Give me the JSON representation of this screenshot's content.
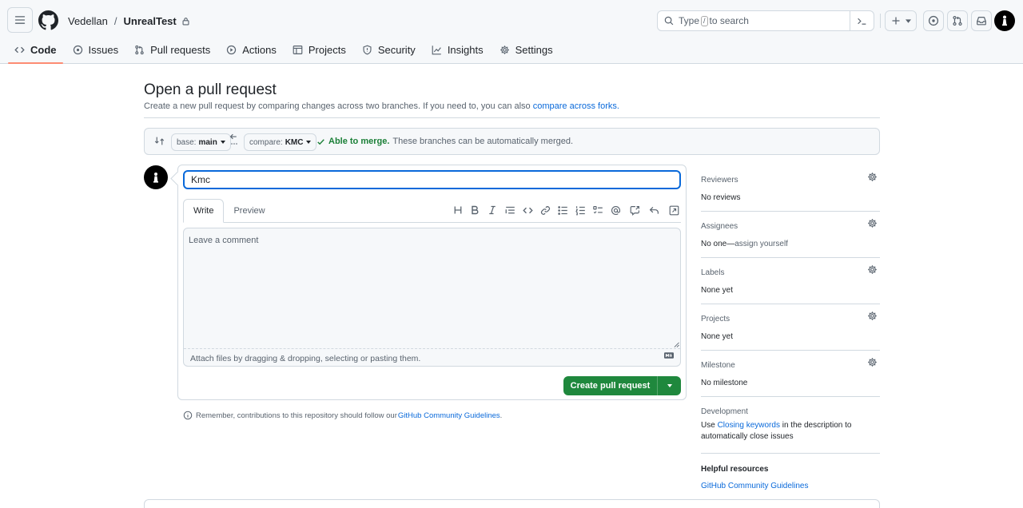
{
  "header": {
    "owner": "Vedellan",
    "separator": "/",
    "repo": "UnrealTest",
    "search": {
      "prefix": "Type",
      "key": "/",
      "suffix": "to search"
    }
  },
  "tabs": [
    {
      "label": "Code",
      "icon": "code-icon"
    },
    {
      "label": "Issues",
      "icon": "issue-opened-icon"
    },
    {
      "label": "Pull requests",
      "icon": "git-pull-request-icon"
    },
    {
      "label": "Actions",
      "icon": "play-icon"
    },
    {
      "label": "Projects",
      "icon": "table-icon"
    },
    {
      "label": "Security",
      "icon": "shield-icon"
    },
    {
      "label": "Insights",
      "icon": "graph-icon"
    },
    {
      "label": "Settings",
      "icon": "gear-icon"
    }
  ],
  "main": {
    "title": "Open a pull request",
    "subtitle": "Create a new pull request by comparing changes across two branches. If you need to, you can also",
    "subtitle_link": "compare across forks."
  },
  "range": {
    "base_label": "base:",
    "base_branch": "main",
    "compare_label": "compare:",
    "compare_branch": "KMC",
    "merge_status": "Able to merge.",
    "merge_detail": "These branches can be automatically merged."
  },
  "form": {
    "title_value": "Kmc",
    "tab_write": "Write",
    "tab_preview": "Preview",
    "comment_placeholder": "Leave a comment",
    "attach_hint": "Attach files by dragging & dropping, selecting or pasting them.",
    "submit_label": "Create pull request",
    "remember_text": "Remember, contributions to this repository should follow our",
    "remember_link": "GitHub Community Guidelines",
    "remember_end": "."
  },
  "sidebar": {
    "reviewers": {
      "title": "Reviewers",
      "value": "No reviews"
    },
    "assignees": {
      "title": "Assignees",
      "value": "No one—",
      "link": "assign yourself"
    },
    "labels": {
      "title": "Labels",
      "value": "None yet"
    },
    "projects": {
      "title": "Projects",
      "value": "None yet"
    },
    "milestone": {
      "title": "Milestone",
      "value": "No milestone"
    },
    "development": {
      "title": "Development",
      "prefix": "Use",
      "link": "Closing keywords",
      "suffix": "in the description to",
      "line2": "automatically close issues"
    },
    "resources": {
      "title": "Helpful resources",
      "link": "GitHub Community Guidelines"
    }
  },
  "colors": {
    "accent": "#0969da",
    "success": "#1f883d",
    "tab_underline": "#fd8c73"
  }
}
